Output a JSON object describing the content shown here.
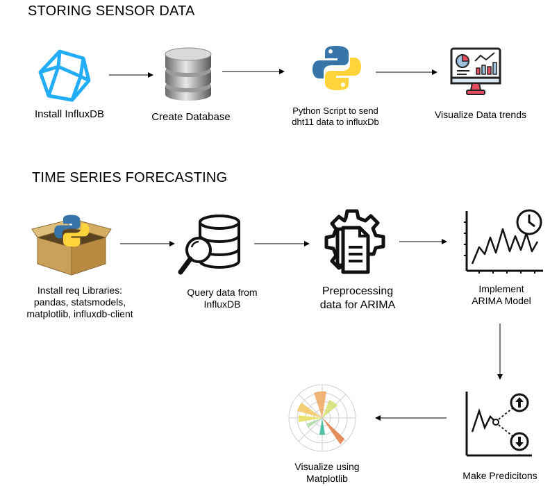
{
  "sections": {
    "storing": "STORING SENSOR DATA",
    "forecasting": "TIME SERIES FORECASTING"
  },
  "storing_steps": [
    {
      "label": "Install InfluxDB",
      "icon": "influxdb-icon"
    },
    {
      "label": "Create Database",
      "icon": "database-icon"
    },
    {
      "label_lines": [
        "Python Script to send",
        "dht11 data to influxDb"
      ],
      "icon": "python-icon"
    },
    {
      "label": "Visualize Data trends",
      "icon": "dashboard-monitor-icon"
    }
  ],
  "forecasting_steps": [
    {
      "label_lines": [
        "Install req Libraries:",
        "pandas, statsmodels,",
        "matplotlib, influxdb-client"
      ],
      "icon": "python-package-icon"
    },
    {
      "label_lines": [
        "Query data from",
        "InfluxDB"
      ],
      "icon": "database-search-icon"
    },
    {
      "label_lines": [
        "Preprocessing",
        "data for ARIMA"
      ],
      "icon": "gear-document-icon"
    },
    {
      "label_lines": [
        "Implement",
        "ARIMA Model"
      ],
      "icon": "time-series-chart-icon"
    },
    {
      "label": "Make Predicitons",
      "icon": "prediction-chart-icon"
    },
    {
      "label_lines": [
        "Visualize using",
        "Matplotlib"
      ],
      "icon": "polar-chart-icon"
    }
  ],
  "colors": {
    "influx_blue": "#22ADF6",
    "python_blue": "#3775A9",
    "python_yellow": "#FFD43B",
    "dashboard_red": "#E84A5F",
    "arrow": "#000000"
  }
}
